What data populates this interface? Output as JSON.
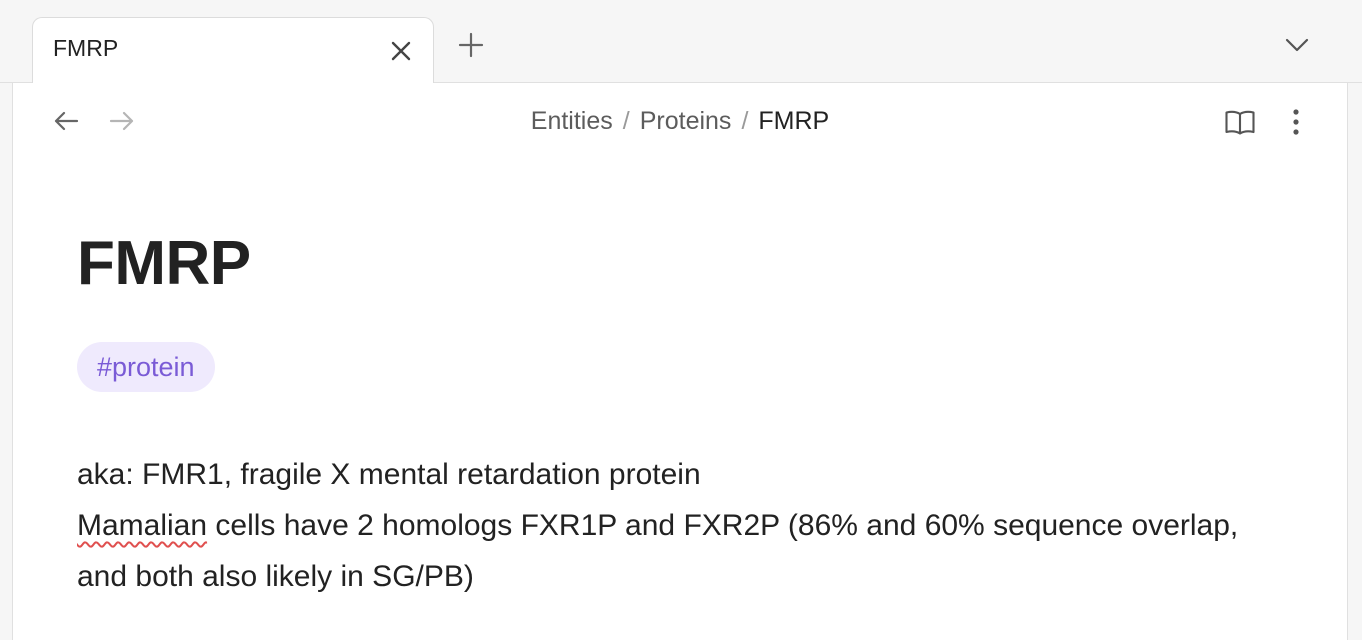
{
  "tabs": [
    {
      "title": "FMRP",
      "active": true
    }
  ],
  "tabbar": {
    "close_icon": "close-icon",
    "new_tab_icon": "plus-icon",
    "tab_list_icon": "chevron-down-icon"
  },
  "nav": {
    "back_icon": "arrow-left-icon",
    "forward_icon": "arrow-right-icon",
    "breadcrumb": [
      "Entities",
      "Proteins",
      "FMRP"
    ],
    "separator": "/",
    "reading_view_icon": "book-open-icon",
    "more_options_icon": "more-vertical-icon"
  },
  "note": {
    "title": "FMRP",
    "tag": "#protein",
    "lines": {
      "aka": "aka: FMR1, fragile X mental retardation protein",
      "misspelled_word": "Mamalian",
      "homologs_rest": " cells have 2 homologs FXR1P and FXR2P (86% and 60% sequence overlap, and both also likely in SG/PB)"
    }
  },
  "colors": {
    "tag_background": "#efeafd",
    "tag_text": "#7a5bd6",
    "spellcheck_underline": "#e0504f"
  }
}
